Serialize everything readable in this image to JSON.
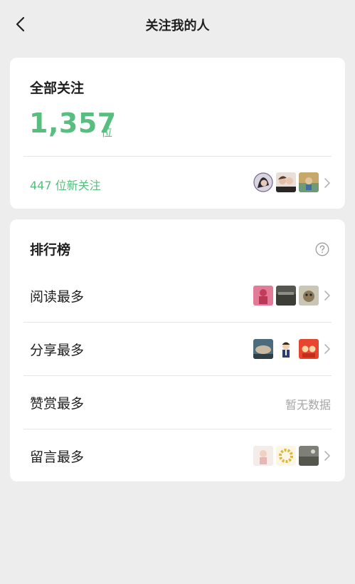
{
  "header": {
    "title": "关注我的人",
    "back_icon": "chevron-left-icon"
  },
  "followers": {
    "section_title": "全部关注",
    "count": "1,357",
    "unit": "位",
    "new_follow_label": "447 位新关注"
  },
  "ranking": {
    "section_title": "排行榜",
    "help_icon": "question-circle-icon",
    "rows": [
      {
        "label": "阅读最多"
      },
      {
        "label": "分享最多"
      },
      {
        "label": "赞赏最多",
        "empty_text": "暂无数据"
      },
      {
        "label": "留言最多"
      }
    ]
  },
  "colors": {
    "accent": "#57be7f",
    "background": "#ededed",
    "card": "#ffffff",
    "muted": "#a6a6a6"
  }
}
